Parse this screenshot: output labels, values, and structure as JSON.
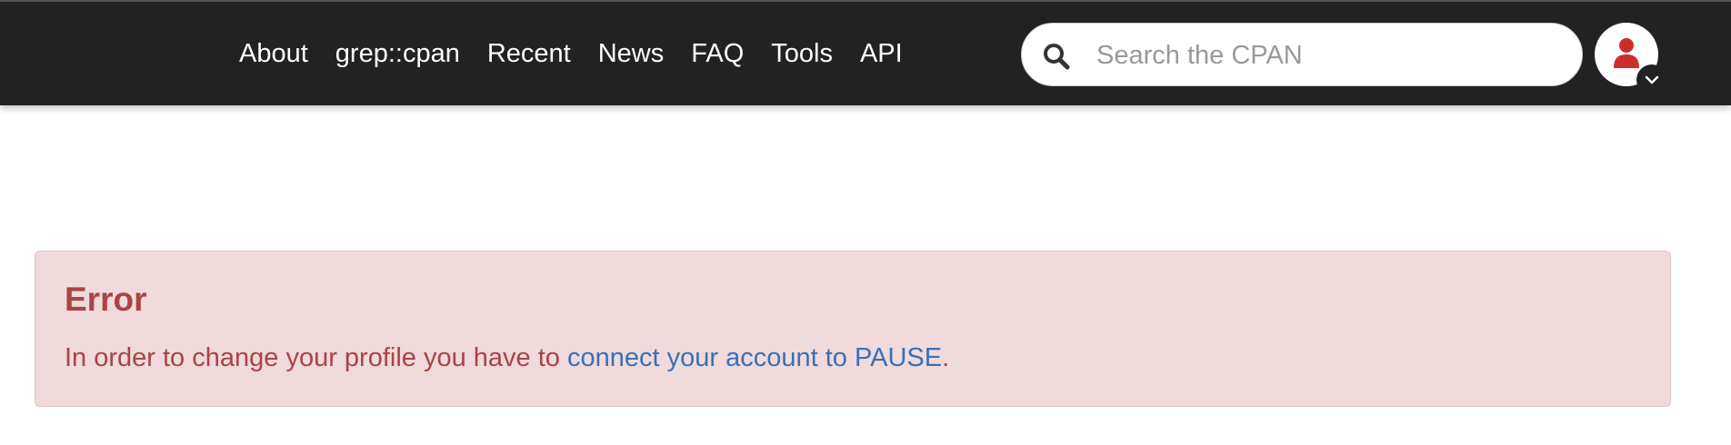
{
  "nav": {
    "links": [
      {
        "label": "About"
      },
      {
        "label": "grep::cpan"
      },
      {
        "label": "Recent"
      },
      {
        "label": "News"
      },
      {
        "label": "FAQ"
      },
      {
        "label": "Tools"
      },
      {
        "label": "API"
      }
    ]
  },
  "search": {
    "placeholder": "Search the CPAN",
    "value": "",
    "icon": "search-icon"
  },
  "user_menu": {
    "icon": "user-icon",
    "chevron_icon": "chevron-down-icon",
    "icon_color": "#c9302c"
  },
  "alert": {
    "title": "Error",
    "message_prefix": "In order to change your profile you have to ",
    "link_text": "connect your account to PAUSE",
    "message_suffix": ".",
    "colors": {
      "background": "#f0dadb",
      "text": "#a94442",
      "link": "#3a70b6"
    }
  },
  "colors": {
    "navbar": "#222222",
    "nav_text": "#ffffff"
  }
}
